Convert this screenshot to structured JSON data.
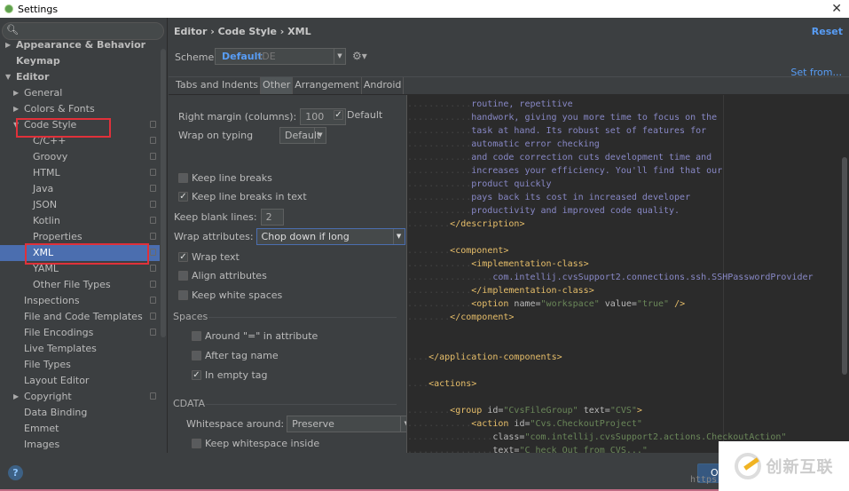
{
  "window": {
    "title": "Settings",
    "close_label": "✕"
  },
  "sidebar": {
    "search_placeholder": "",
    "items": [
      {
        "label": "Appearance & Behavior",
        "level": 0,
        "arrow": "▶",
        "bold": true
      },
      {
        "label": "Keymap",
        "level": 0,
        "bold": true
      },
      {
        "label": "Editor",
        "level": 0,
        "arrow": "▼",
        "bold": true
      },
      {
        "label": "General",
        "level": 1,
        "arrow": "▶"
      },
      {
        "label": "Colors & Fonts",
        "level": 1,
        "arrow": "▶"
      },
      {
        "label": "Code Style",
        "level": 1,
        "arrow": "▼",
        "cfg": true
      },
      {
        "label": "C/C++",
        "level": 2,
        "cfg": true
      },
      {
        "label": "Groovy",
        "level": 2,
        "cfg": true
      },
      {
        "label": "HTML",
        "level": 2,
        "cfg": true
      },
      {
        "label": "Java",
        "level": 2,
        "cfg": true
      },
      {
        "label": "JSON",
        "level": 2,
        "cfg": true
      },
      {
        "label": "Kotlin",
        "level": 2,
        "cfg": true
      },
      {
        "label": "Properties",
        "level": 2,
        "cfg": true
      },
      {
        "label": "XML",
        "level": 2,
        "cfg": true,
        "selected": true
      },
      {
        "label": "YAML",
        "level": 2,
        "cfg": true
      },
      {
        "label": "Other File Types",
        "level": 2,
        "cfg": true
      },
      {
        "label": "Inspections",
        "level": 1,
        "cfg": true
      },
      {
        "label": "File and Code Templates",
        "level": 1,
        "cfg": true
      },
      {
        "label": "File Encodings",
        "level": 1,
        "cfg": true
      },
      {
        "label": "Live Templates",
        "level": 1
      },
      {
        "label": "File Types",
        "level": 1
      },
      {
        "label": "Layout Editor",
        "level": 1
      },
      {
        "label": "Copyright",
        "level": 1,
        "arrow": "▶",
        "cfg": true
      },
      {
        "label": "Data Binding",
        "level": 1
      },
      {
        "label": "Emmet",
        "level": 1
      },
      {
        "label": "Images",
        "level": 1
      }
    ]
  },
  "header": {
    "breadcrumb": "Editor › Code Style › XML",
    "reset_label": "Reset",
    "scheme_label": "Scheme:",
    "scheme_value": "Default",
    "scheme_suffix": "IDE",
    "set_from_label": "Set from..."
  },
  "tabs": [
    {
      "label": "Tabs and Indents",
      "active": false
    },
    {
      "label": "Other",
      "active": true
    },
    {
      "label": "Arrangement",
      "active": false
    },
    {
      "label": "Android",
      "active": false
    }
  ],
  "options": {
    "right_margin_label": "Right margin (columns):",
    "right_margin_value": "100",
    "right_margin_default_label": "Default",
    "right_margin_default_checked": true,
    "wrap_on_typing_label": "Wrap on typing",
    "wrap_on_typing_value": "Default",
    "keep_line_breaks_label": "Keep line breaks",
    "keep_line_breaks_checked": false,
    "keep_line_breaks_text_label": "Keep line breaks in text",
    "keep_line_breaks_text_checked": true,
    "keep_blank_lines_label": "Keep blank lines:",
    "keep_blank_lines_value": "2",
    "wrap_attributes_label": "Wrap attributes:",
    "wrap_attributes_value": "Chop down if long",
    "wrap_text_label": "Wrap text",
    "wrap_text_checked": true,
    "align_attributes_label": "Align attributes",
    "align_attributes_checked": false,
    "keep_white_spaces_label": "Keep white spaces",
    "keep_white_spaces_checked": false,
    "spaces_section": "Spaces",
    "around_eq_label": "Around \"=\" in attribute",
    "around_eq_checked": false,
    "after_tag_name_label": "After tag name",
    "after_tag_name_checked": false,
    "in_empty_tag_label": "In empty tag",
    "in_empty_tag_checked": true,
    "cdata_section": "CDATA",
    "whitespace_around_label": "Whitespace around:",
    "whitespace_around_value": "Preserve",
    "keep_ws_inside_label": "Keep whitespace inside",
    "keep_ws_inside_checked": false
  },
  "preview": {
    "lines": [
      {
        "indent": "............",
        "parts": [
          {
            "c": "txt",
            "t": "routine, repetitive"
          }
        ]
      },
      {
        "indent": "............",
        "parts": [
          {
            "c": "txt",
            "t": "handwork, giving you more time to focus on the"
          }
        ]
      },
      {
        "indent": "............",
        "parts": [
          {
            "c": "txt",
            "t": "task at hand. Its robust set of features for"
          }
        ]
      },
      {
        "indent": "............",
        "parts": [
          {
            "c": "txt",
            "t": "automatic error checking"
          }
        ]
      },
      {
        "indent": "............",
        "parts": [
          {
            "c": "txt",
            "t": "and code correction cuts development time and"
          }
        ]
      },
      {
        "indent": "............",
        "parts": [
          {
            "c": "txt",
            "t": "increases your efficiency. You'll find that our"
          }
        ]
      },
      {
        "indent": "............",
        "parts": [
          {
            "c": "txt",
            "t": "product quickly"
          }
        ]
      },
      {
        "indent": "............",
        "parts": [
          {
            "c": "txt",
            "t": "pays back its cost in increased developer"
          }
        ]
      },
      {
        "indent": "............",
        "parts": [
          {
            "c": "txt",
            "t": "productivity and improved code quality."
          }
        ]
      },
      {
        "indent": "........",
        "parts": [
          {
            "c": "tag",
            "t": "</description>"
          }
        ]
      },
      {
        "indent": "",
        "parts": []
      },
      {
        "indent": "........",
        "parts": [
          {
            "c": "tag",
            "t": "<component>"
          }
        ]
      },
      {
        "indent": "............",
        "parts": [
          {
            "c": "tag",
            "t": "<implementation-class>"
          }
        ]
      },
      {
        "indent": "................",
        "parts": [
          {
            "c": "txt",
            "t": "com.intellij.cvsSupport2.connections.ssh.SSHPasswordProvider"
          }
        ]
      },
      {
        "indent": "............",
        "parts": [
          {
            "c": "tag",
            "t": "</implementation-class>"
          }
        ]
      },
      {
        "indent": "............",
        "parts": [
          {
            "c": "tag",
            "t": "<option "
          },
          {
            "c": "attr",
            "t": "name="
          },
          {
            "c": "str",
            "t": "\"workspace\""
          },
          {
            "c": "attr",
            "t": " value="
          },
          {
            "c": "str",
            "t": "\"true\""
          },
          {
            "c": "tag",
            "t": " />"
          }
        ]
      },
      {
        "indent": "........",
        "parts": [
          {
            "c": "tag",
            "t": "</component>"
          }
        ]
      },
      {
        "indent": "",
        "parts": []
      },
      {
        "indent": "",
        "parts": []
      },
      {
        "indent": "....",
        "parts": [
          {
            "c": "tag",
            "t": "</application-components>"
          }
        ]
      },
      {
        "indent": "",
        "parts": []
      },
      {
        "indent": "....",
        "parts": [
          {
            "c": "tag",
            "t": "<actions>"
          }
        ]
      },
      {
        "indent": "",
        "parts": []
      },
      {
        "indent": "........",
        "parts": [
          {
            "c": "tag",
            "t": "<group "
          },
          {
            "c": "attr",
            "t": "id="
          },
          {
            "c": "str",
            "t": "\"CvsFileGroup\""
          },
          {
            "c": "attr",
            "t": " text="
          },
          {
            "c": "str",
            "t": "\"CVS\""
          },
          {
            "c": "tag",
            "t": ">"
          }
        ]
      },
      {
        "indent": "............",
        "parts": [
          {
            "c": "tag",
            "t": "<action "
          },
          {
            "c": "attr",
            "t": "id="
          },
          {
            "c": "str",
            "t": "\"Cvs.CheckoutProject\""
          }
        ]
      },
      {
        "indent": "................",
        "parts": [
          {
            "c": "attr",
            "t": "class="
          },
          {
            "c": "str",
            "t": "\"com.intellij.cvsSupport2.actions.CheckoutAction\""
          }
        ]
      },
      {
        "indent": "................",
        "parts": [
          {
            "c": "attr",
            "t": "text="
          },
          {
            "c": "str",
            "t": "\"C_heck Out from CVS...\""
          }
        ]
      }
    ]
  },
  "footer": {
    "help_label": "?",
    "ok_label": "OK",
    "url_fragment": "https"
  },
  "watermark": {
    "text": "创新互联"
  },
  "colors": {
    "accent": "#589df6",
    "selection": "#4b6eaf",
    "highlight_box": "#e0313a"
  }
}
